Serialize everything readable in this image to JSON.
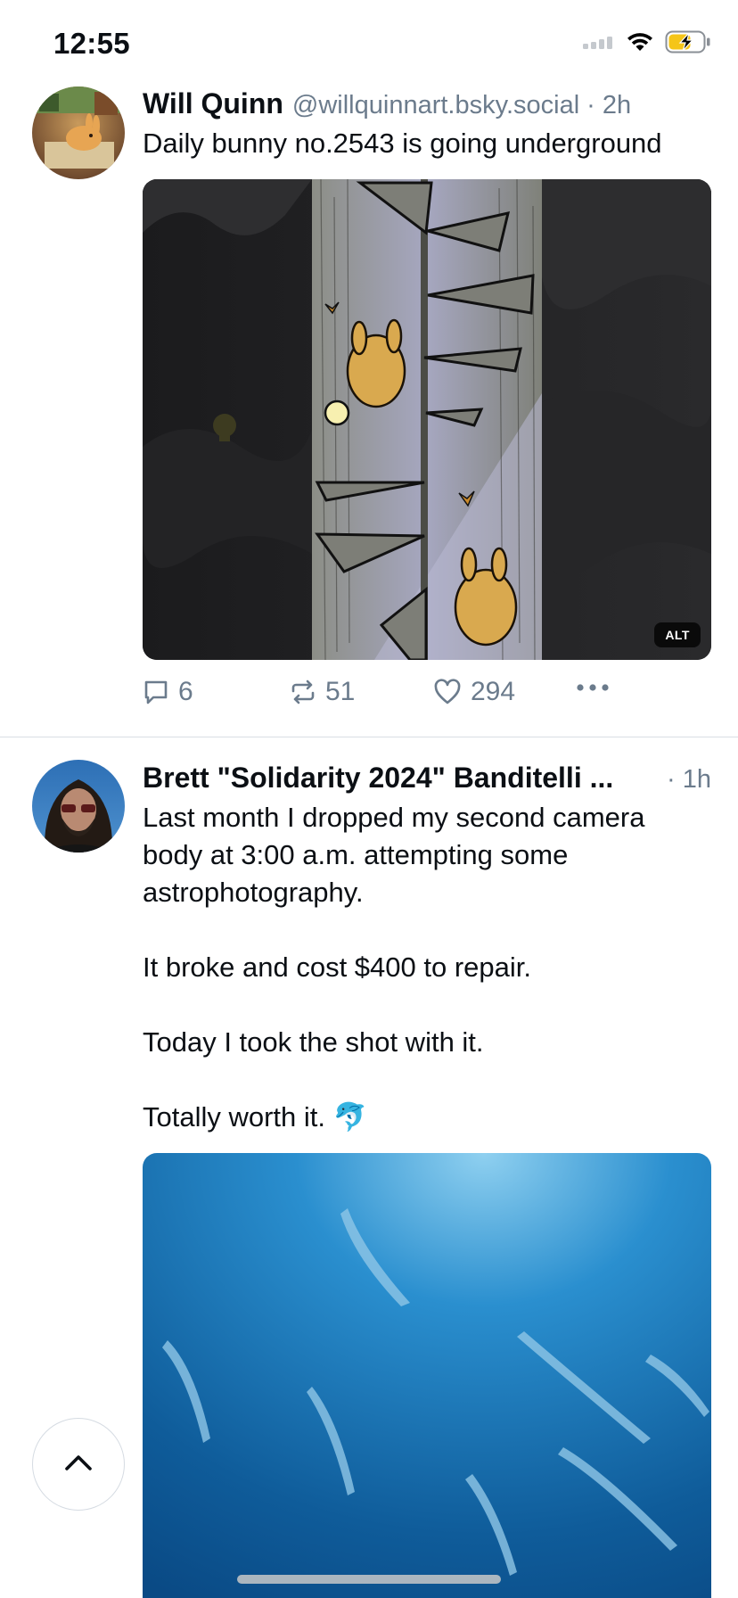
{
  "status_bar": {
    "time": "12:55",
    "icons": [
      "cellular-signal-icon",
      "wifi-icon",
      "battery-charging-icon"
    ]
  },
  "posts": [
    {
      "author_name": "Will Quinn",
      "author_handle": "@willquinnart.bsky.social",
      "time": "· 2h",
      "text": "Daily bunny no.2543 is going underground",
      "media_alt_badge": "ALT",
      "counts": {
        "replies": "6",
        "reposts": "51",
        "likes": "294"
      }
    },
    {
      "author_name": "Brett \"Solidarity 2024\" Banditelli ...",
      "time": "· 1h",
      "text": "Last month I dropped my second camera body at 3:00 a.m. attempting some astrophotography.\n\nIt broke and cost $400 to repair.\n\nToday I took the shot with it.\n\nTotally worth it. 🐬"
    }
  ],
  "colors": {
    "accent_muted": "#6b7b8c",
    "text": "#0b0f14",
    "divider": "#d9dee4",
    "battery_charge": "#f5c518"
  },
  "icons": {
    "reply": "speech-bubble-icon",
    "repost": "repost-icon",
    "like": "heart-icon",
    "more": "ellipsis-icon",
    "scroll_top": "chevron-up-icon"
  }
}
